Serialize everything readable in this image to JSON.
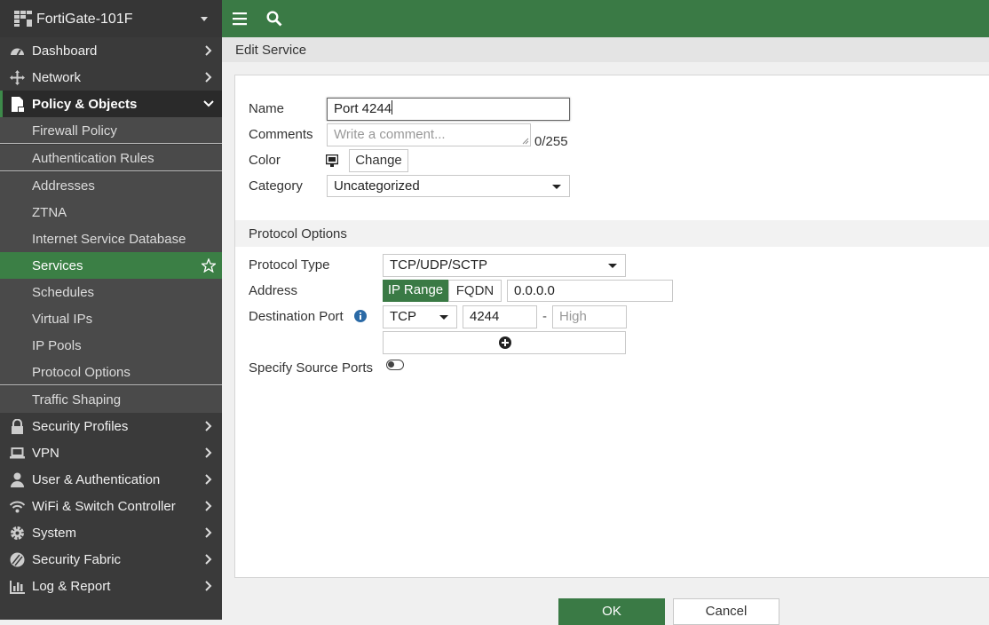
{
  "device": {
    "name": "FortiGate-101F"
  },
  "nav": {
    "dashboard": "Dashboard",
    "network": "Network",
    "policy_objects": "Policy & Objects",
    "policy_sub": {
      "firewall_policy": "Firewall Policy",
      "authentication_rules": "Authentication Rules",
      "addresses": "Addresses",
      "ztna": "ZTNA",
      "internet_service_database": "Internet Service Database",
      "services": "Services",
      "schedules": "Schedules",
      "virtual_ips": "Virtual IPs",
      "ip_pools": "IP Pools",
      "protocol_options": "Protocol Options",
      "traffic_shaping": "Traffic Shaping"
    },
    "security_profiles": "Security Profiles",
    "vpn": "VPN",
    "user_authentication": "User & Authentication",
    "wifi_switch": "WiFi & Switch Controller",
    "system": "System",
    "security_fabric": "Security Fabric",
    "log_report": "Log & Report"
  },
  "page": {
    "title": "Edit Service"
  },
  "form": {
    "name_label": "Name",
    "name_value": "Port 4244",
    "comments_label": "Comments",
    "comments_placeholder": "Write a comment...",
    "comments_count": "0/255",
    "color_label": "Color",
    "color_change": "Change",
    "category_label": "Category",
    "category_value": "Uncategorized"
  },
  "protocol": {
    "section_title": "Protocol Options",
    "type_label": "Protocol Type",
    "type_value": "TCP/UDP/SCTP",
    "address_label": "Address",
    "address_ip_range": "IP Range",
    "address_fqdn": "FQDN",
    "address_value": "0.0.0.0",
    "dest_port_label": "Destination Port",
    "dest_protocol": "TCP",
    "dest_low": "4244",
    "dest_dash": "-",
    "dest_high_placeholder": "High",
    "source_ports_label": "Specify Source Ports"
  },
  "footer": {
    "ok": "OK",
    "cancel": "Cancel"
  },
  "colors": {
    "accent": "#3a7a45",
    "sidebar": "#3a3a3a"
  }
}
